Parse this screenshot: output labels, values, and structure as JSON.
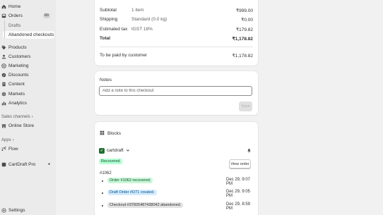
{
  "sidebar": {
    "home": "Home",
    "orders": "Orders",
    "orders_count": "60",
    "drafts": "Drafts",
    "abandoned": "Abandoned checkouts",
    "products": "Products",
    "customers": "Customers",
    "marketing": "Marketing",
    "discounts": "Discounts",
    "content": "Content",
    "markets": "Markets",
    "analytics": "Analytics",
    "sales_channels": "Sales channels",
    "online_store": "Online Store",
    "apps": "Apps",
    "flow": "Flow",
    "cartdraft_pro": "CartDraft Pro",
    "settings": "Settings"
  },
  "summary": {
    "subtotal_label": "Subtotal",
    "subtotal_detail": "1 item",
    "subtotal_amount": "₹999.00",
    "shipping_label": "Shipping",
    "shipping_detail": "Standard (0.0 kg)",
    "shipping_amount": "₹0.00",
    "tax_label": "Estimated tax",
    "tax_detail": "IGST 18%",
    "tax_amount": "₹179.82",
    "total_label": "Total",
    "total_amount": "₹1,178.82",
    "paid_label": "To be paid by customer",
    "paid_amount": "₹1,178.82"
  },
  "notes": {
    "title": "Notes",
    "placeholder": "Add a note to this checkout",
    "save_label": "Save"
  },
  "blocks": {
    "title": "Blocks",
    "app_name": "cartdraft",
    "status": "Recovered",
    "view_order": "View order",
    "checkout_id": "#1062",
    "events": [
      {
        "text": "Order #1062 recovered.",
        "time": "Dec 29, 9:07 PM"
      },
      {
        "text": "Draft Order #D71 created.",
        "time": "Dec 29, 9:05 PM"
      },
      {
        "text": "Checkout #37825487438042 abandoned.",
        "time": "Dec 29, 8:59 PM"
      }
    ]
  },
  "colors": {
    "recovered_bg": "#b4fed2",
    "recovered_text": "#0c5132",
    "event1_bg": "#c9f7d6",
    "event2_bg": "#d5ebff",
    "event3_bg": "#e3e3e3"
  }
}
